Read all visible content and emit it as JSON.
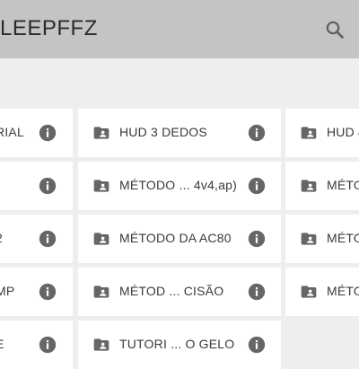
{
  "appbar": {
    "title": "LEEPFFZ",
    "search_icon": "search-icon"
  },
  "folders": [
    {
      "label": "RIAL",
      "icon": "info-icon"
    },
    {
      "label": "HUD 3 DEDOS",
      "icon": "folder-shared-icon"
    },
    {
      "label": "HUD 4",
      "icon": "folder-shared-icon"
    },
    {
      "label": "",
      "icon": "info-icon"
    },
    {
      "label": "MÉTODO ... 4v4,ap)",
      "icon": "folder-shared-icon"
    },
    {
      "label": "MÉTO",
      "icon": "folder-shared-icon"
    },
    {
      "label": "2",
      "icon": "info-icon"
    },
    {
      "label": "MÉTODO DA AC80",
      "icon": "folder-shared-icon"
    },
    {
      "label": "MÉTO",
      "icon": "folder-shared-icon"
    },
    {
      "label": "MP",
      "icon": "info-icon"
    },
    {
      "label": "MÉTOD ... CISÃO",
      "icon": "folder-shared-icon"
    },
    {
      "label": "MÉTO",
      "icon": "folder-shared-icon"
    },
    {
      "label": "E",
      "icon": "info-icon"
    },
    {
      "label": "TUTORI ... O GELO",
      "icon": "folder-shared-icon"
    }
  ],
  "colors": {
    "appbar": "#c4c4c4",
    "background": "#eeeeee",
    "card": "#ffffff",
    "icon": "#666666",
    "text": "#3a3a3a"
  }
}
